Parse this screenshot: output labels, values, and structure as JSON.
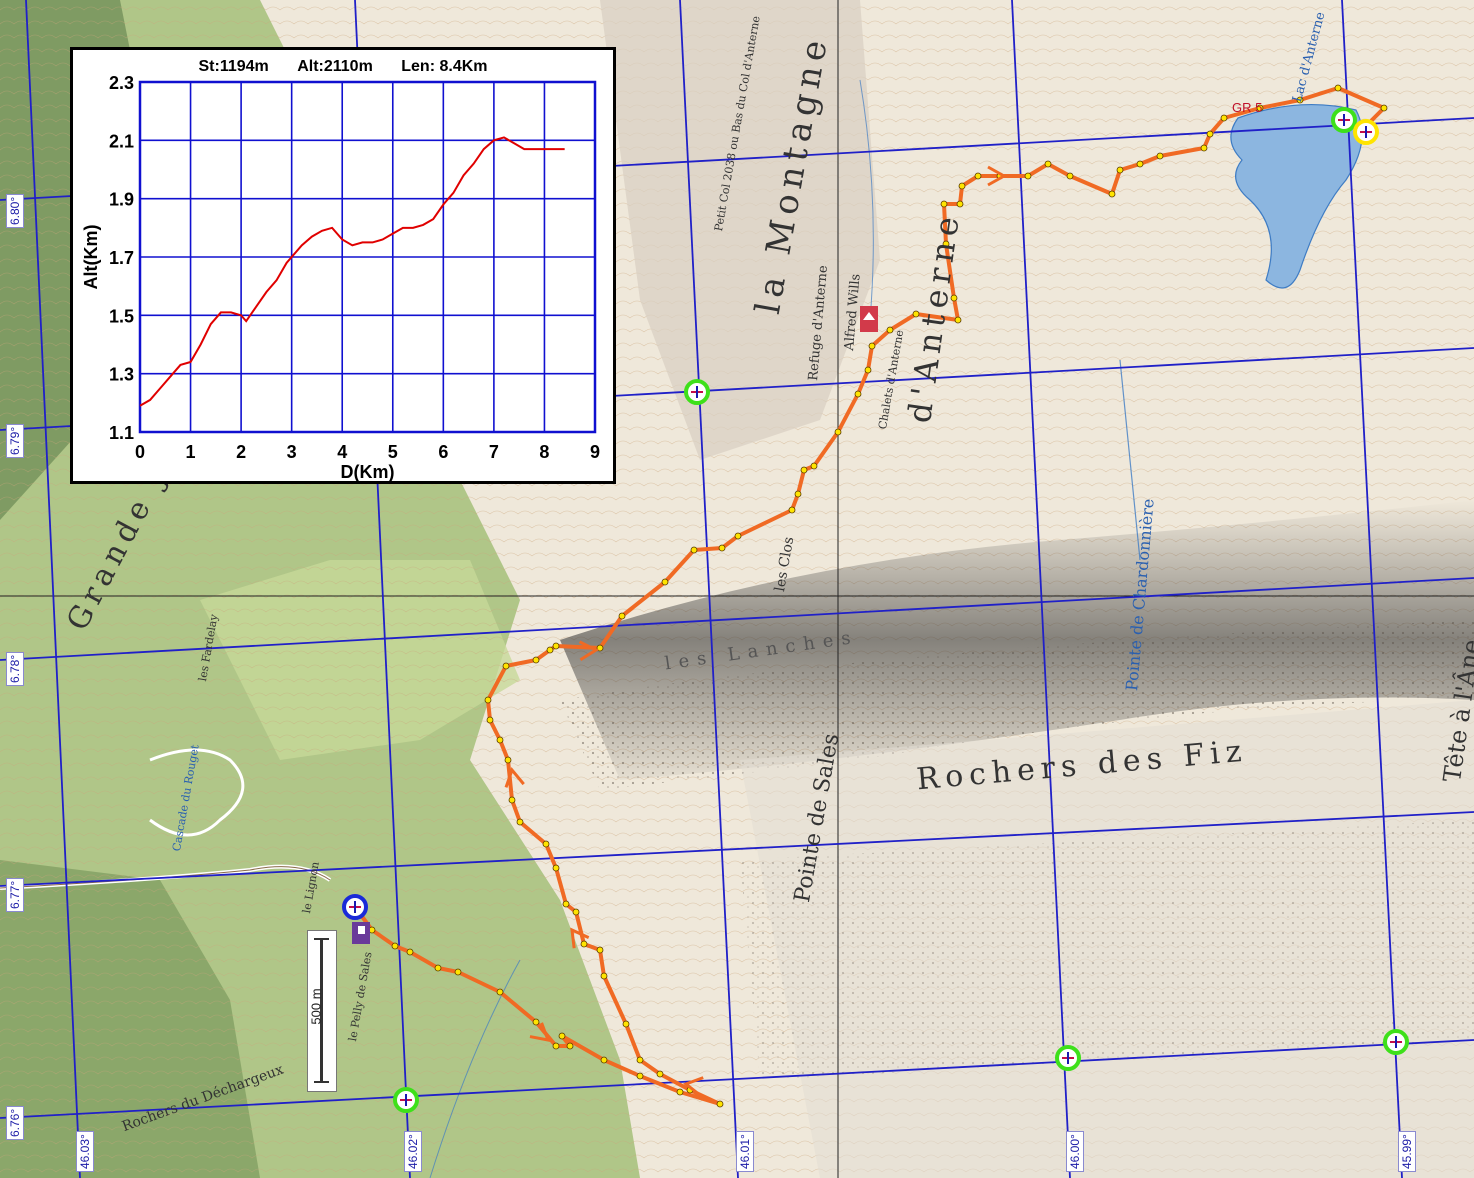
{
  "colors": {
    "grid": "#2020c8",
    "route": "#f06a24",
    "waypoint": "#ffe400",
    "marker_ring": "#3ee01a",
    "start_ring": "#1a2ad8",
    "end_ring": "#ffe400",
    "lake": "#8cb6e0",
    "profile_line": "#e00000",
    "profile_grid": "#1010d0"
  },
  "coordinates": {
    "longitude": [
      "6.80°",
      "6.79°",
      "6.78°",
      "6.77°",
      "6.76°"
    ],
    "latitude": [
      "46.03°",
      "46.02°",
      "46.01°",
      "46.00°",
      "45.99°"
    ]
  },
  "scale_bar": {
    "label": "500 m"
  },
  "map_labels": [
    {
      "text": "la Montagne",
      "icon": "place"
    },
    {
      "text": "d'Anterne",
      "icon": "place"
    },
    {
      "text": "Rochers des Fiz",
      "icon": "place"
    },
    {
      "text": "Pointe de Sales",
      "icon": "place"
    },
    {
      "text": "Tête à l'Âne",
      "icon": "place"
    },
    {
      "text": "les Lanches",
      "icon": "place"
    },
    {
      "text": "Refuge d'Anterne",
      "icon": "hut"
    },
    {
      "text": "Alfred Wills",
      "icon": "hut"
    },
    {
      "text": "Lac d'Anterne",
      "icon": "lake"
    },
    {
      "text": "GR 5",
      "icon": "trail"
    },
    {
      "text": "Grande Jo",
      "icon": "place"
    },
    {
      "text": "Rochers du Déchargeux",
      "icon": "place"
    },
    {
      "text": "le Lignon",
      "icon": "place"
    },
    {
      "text": "le Pelly de Sales",
      "icon": "place"
    },
    {
      "text": "les Fardelay",
      "icon": "place"
    },
    {
      "text": "Cascade du Rouget",
      "icon": "place"
    },
    {
      "text": "Chalets d'Anterne",
      "icon": "hut"
    },
    {
      "text": "Petit Col 2038 ou Bas du Col d'Anterne",
      "icon": "pass"
    },
    {
      "text": "Pointe de Chardonnière",
      "icon": "place"
    },
    {
      "text": "les Clos",
      "icon": "place"
    }
  ],
  "profile": {
    "stats": {
      "start": "St:1194m",
      "altitude": "Alt:2110m",
      "length": "Len: 8.4Km"
    },
    "chart_data": {
      "type": "line",
      "xlabel": "D(Km)",
      "ylabel": "Alt(Km)",
      "xlim": [
        0,
        9
      ],
      "ylim": [
        1.1,
        2.3
      ],
      "x_ticks": [
        "0",
        "1",
        "2",
        "3",
        "4",
        "5",
        "6",
        "7",
        "8",
        "9"
      ],
      "y_ticks": [
        "1.1",
        "1.3",
        "1.5",
        "1.7",
        "1.9",
        "2.1",
        "2.3"
      ],
      "grid": true,
      "series": [
        {
          "x": [
            0.0,
            0.2,
            0.4,
            0.6,
            0.8,
            1.0,
            1.2,
            1.4,
            1.6,
            1.8,
            2.0,
            2.1,
            2.3,
            2.5,
            2.7,
            2.9,
            3.0,
            3.2,
            3.4,
            3.6,
            3.8,
            4.0,
            4.2,
            4.4,
            4.6,
            4.8,
            5.0,
            5.2,
            5.4,
            5.6,
            5.8,
            6.0,
            6.2,
            6.4,
            6.6,
            6.8,
            7.0,
            7.2,
            7.4,
            7.6,
            7.8,
            8.0,
            8.2,
            8.4
          ],
          "y": [
            1.19,
            1.21,
            1.25,
            1.29,
            1.33,
            1.34,
            1.4,
            1.47,
            1.51,
            1.51,
            1.5,
            1.48,
            1.53,
            1.58,
            1.62,
            1.68,
            1.7,
            1.74,
            1.77,
            1.79,
            1.8,
            1.76,
            1.74,
            1.75,
            1.75,
            1.76,
            1.78,
            1.8,
            1.8,
            1.81,
            1.83,
            1.88,
            1.92,
            1.98,
            2.02,
            2.07,
            2.1,
            2.11,
            2.09,
            2.07,
            2.07,
            2.07,
            2.07,
            2.07
          ]
        }
      ]
    }
  }
}
